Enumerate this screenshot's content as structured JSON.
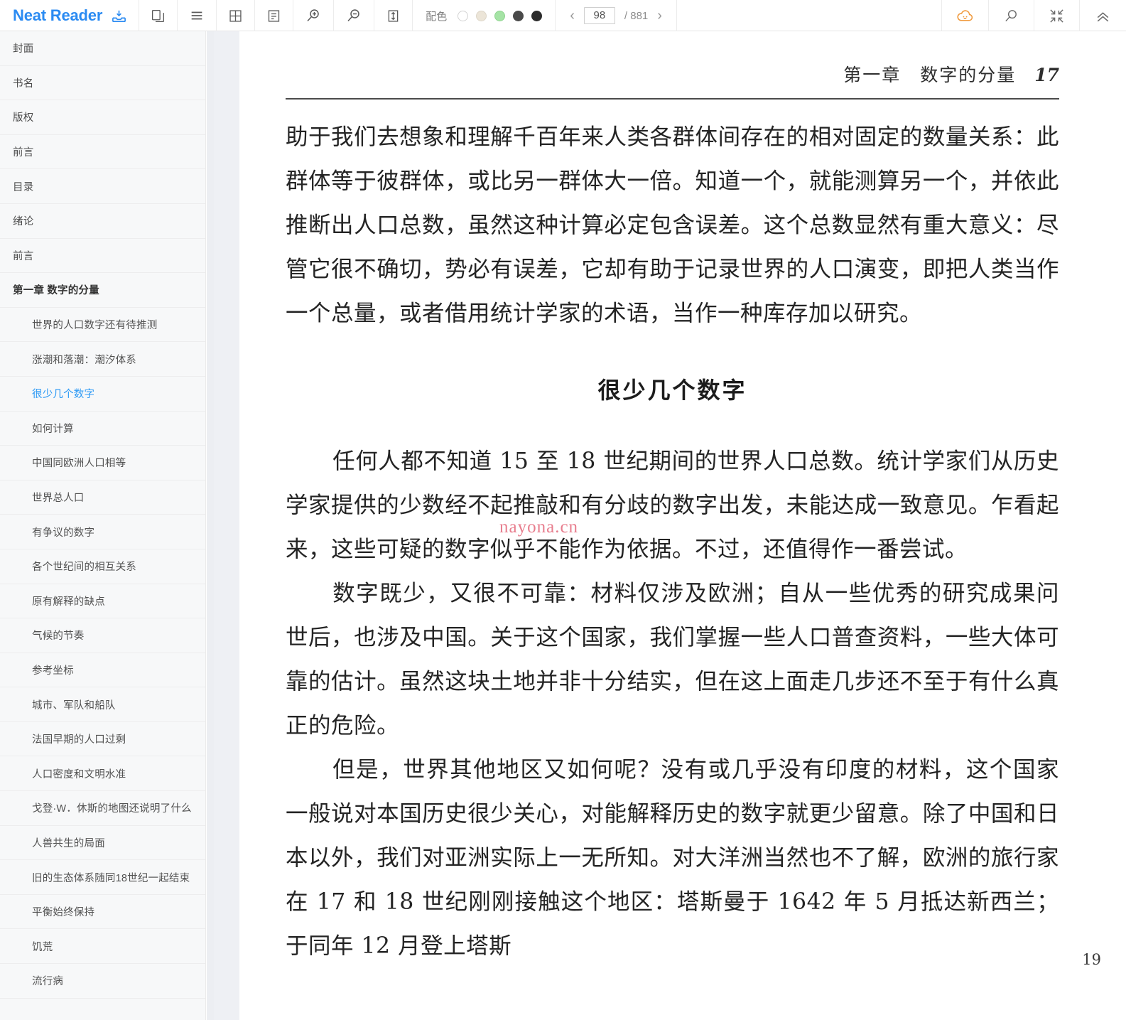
{
  "app": {
    "brand": "Neat Reader",
    "brand_color": "#2b8bf2"
  },
  "toolbar": {
    "icons": [
      {
        "name": "download-to-shelf-icon",
        "title": "导入"
      },
      {
        "name": "copy-pages-icon",
        "title": "双页"
      },
      {
        "name": "list-menu-icon",
        "title": "目录"
      },
      {
        "name": "grid-layout-icon",
        "title": "网格"
      },
      {
        "name": "notes-panel-icon",
        "title": "笔记"
      },
      {
        "name": "zoom-in-icon",
        "title": "放大"
      },
      {
        "name": "zoom-out-icon",
        "title": "缩小"
      },
      {
        "name": "fit-height-icon",
        "title": "适应高度"
      }
    ],
    "colors_label": "配色",
    "color_swatches": [
      {
        "name": "theme-white",
        "hex": "#ffffff",
        "selected": false
      },
      {
        "name": "theme-sepia",
        "hex": "#ece5d8",
        "selected": false
      },
      {
        "name": "theme-green",
        "hex": "#a5e3a5",
        "selected": true
      },
      {
        "name": "theme-dark-gray",
        "hex": "#4a4a4a",
        "selected": false
      },
      {
        "name": "theme-black",
        "hex": "#2b2b2b",
        "selected": false
      }
    ],
    "pager": {
      "prev_label": "‹",
      "next_label": "›",
      "current_page": "98",
      "total_label": "/ 881"
    },
    "right_icons": [
      {
        "name": "cloud-sync-icon",
        "title": "云同步",
        "hex": "#f09a3e"
      },
      {
        "name": "search-icon",
        "title": "搜索"
      },
      {
        "name": "fullscreen-collapse-icon",
        "title": "全屏"
      },
      {
        "name": "collapse-toolbar-icon",
        "title": "收起"
      }
    ]
  },
  "sidebar": {
    "items": [
      {
        "label": "封面",
        "level": 1,
        "active": false
      },
      {
        "label": "书名",
        "level": 1,
        "active": false
      },
      {
        "label": "版权",
        "level": 1,
        "active": false
      },
      {
        "label": "前言",
        "level": 1,
        "active": false
      },
      {
        "label": "目录",
        "level": 1,
        "active": false
      },
      {
        "label": "绪论",
        "level": 1,
        "active": false
      },
      {
        "label": "前言",
        "level": 1,
        "active": false
      },
      {
        "label": "第一章 数字的分量",
        "level": 1,
        "chapter": true,
        "active": false
      },
      {
        "label": "世界的人口数字还有待推测",
        "level": 2,
        "active": false
      },
      {
        "label": "涨潮和落潮：潮汐体系",
        "level": 2,
        "active": false
      },
      {
        "label": "很少几个数字",
        "level": 2,
        "active": true
      },
      {
        "label": "如何计算",
        "level": 2,
        "active": false
      },
      {
        "label": "中国同欧洲人口相等",
        "level": 2,
        "active": false
      },
      {
        "label": "世界总人口",
        "level": 2,
        "active": false
      },
      {
        "label": "有争议的数字",
        "level": 2,
        "active": false
      },
      {
        "label": "各个世纪间的相互关系",
        "level": 2,
        "active": false
      },
      {
        "label": "原有解释的缺点",
        "level": 2,
        "active": false
      },
      {
        "label": "气候的节奏",
        "level": 2,
        "active": false
      },
      {
        "label": "参考坐标",
        "level": 2,
        "active": false
      },
      {
        "label": "城市、军队和船队",
        "level": 2,
        "active": false
      },
      {
        "label": "法国早期的人口过剩",
        "level": 2,
        "active": false
      },
      {
        "label": "人口密度和文明水准",
        "level": 2,
        "active": false
      },
      {
        "label": "戈登·W．休斯的地图还说明了什么",
        "level": 2,
        "active": false
      },
      {
        "label": "人兽共生的局面",
        "level": 2,
        "active": false
      },
      {
        "label": "旧的生态体系随同18世纪一起结束",
        "level": 2,
        "active": false
      },
      {
        "label": "平衡始终保持",
        "level": 2,
        "active": false
      },
      {
        "label": "饥荒",
        "level": 2,
        "active": false
      },
      {
        "label": "流行病",
        "level": 2,
        "active": false
      }
    ]
  },
  "page": {
    "running_head": "第一章　数字的分量",
    "folio": "17",
    "paragraphs": [
      {
        "id": "p1",
        "indent": false,
        "text": "助于我们去想象和理解千百年来人类各群体间存在的相对固定的数量关系：此群体等于彼群体，或比另一群体大一倍。知道一个，就能测算另一个，并依此推断出人口总数，虽然这种计算必定包含误差。这个总数显然有重大意义：尽管它很不确切，势必有误差，它却有助于记录世界的人口演变，即把人类当作一个总量，或者借用统计学家的术语，当作一种库存加以研究。"
      },
      {
        "id": "p2",
        "indent": true,
        "text": "任何人都不知道 15 至 18 世纪期间的世界人口总数。统计学家们从历史学家提供的少数经不起推敲和有分歧的数字出发，未能达成一致意见。乍看起来，这些可疑的数字似乎不能作为依据。不过，还值得作一番尝试。"
      },
      {
        "id": "p3",
        "indent": true,
        "text": "数字既少，又很不可靠：材料仅涉及欧洲；自从一些优秀的研究成果问世后，也涉及中国。关于这个国家，我们掌握一些人口普查资料，一些大体可靠的估计。虽然这块土地并非十分结实，但在这上面走几步还不至于有什么真正的危险。"
      },
      {
        "id": "p4",
        "indent": true,
        "text": "但是，世界其他地区又如何呢？没有或几乎没有印度的材料，这个国家一般说对本国历史很少关心，对能解释历史的数字就更少留意。除了中国和日本以外，我们对亚洲实际上一无所知。对大洋洲当然也不了解，欧洲的旅行家在 17 和 18 世纪刚刚接触这个地区：塔斯曼于 1642 年 5 月抵达新西兰；于同年 12 月登上塔斯"
      }
    ],
    "section_title": "很少几个数字",
    "watermark": "nayona.cn",
    "side_note": "19"
  }
}
